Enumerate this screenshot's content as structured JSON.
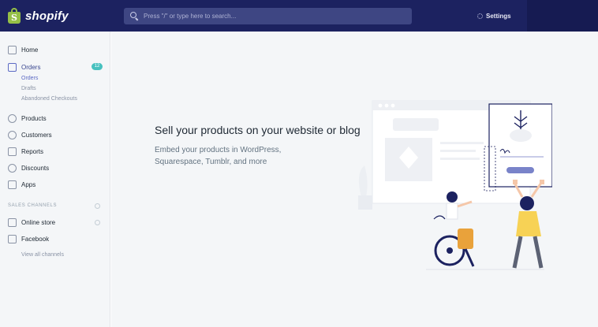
{
  "topbar": {
    "brand": "shopify",
    "search_placeholder": "Press \"/\" or type here to search...",
    "settings_label": "Settings"
  },
  "sidebar": {
    "items": [
      {
        "label": "Home",
        "icon": "home-icon"
      },
      {
        "label": "Orders",
        "icon": "orders-icon",
        "badge": "12"
      },
      {
        "label": "Products",
        "icon": "tag-icon"
      },
      {
        "label": "Customers",
        "icon": "person-icon"
      },
      {
        "label": "Reports",
        "icon": "bar-chart-icon"
      },
      {
        "label": "Discounts",
        "icon": "discount-icon"
      },
      {
        "label": "Apps",
        "icon": "apps-icon"
      }
    ],
    "orders_subitems": [
      "Orders",
      "Drafts",
      "Abandoned Checkouts"
    ],
    "sales_channels_label": "SALES CHANNELS",
    "channels": [
      {
        "label": "Online store",
        "icon": "store-icon"
      },
      {
        "label": "Facebook",
        "icon": "facebook-icon"
      }
    ],
    "view_all": "View all channels"
  },
  "main": {
    "headline": "Sell your products on your website or blog",
    "subtext": "Embed your products in WordPress, Squarespace, Tumblr, and more"
  },
  "colors": {
    "topbar": "#1c2260",
    "accent": "#5c6ac4",
    "badge": "#47c1bf",
    "brand": "#95bf47"
  }
}
